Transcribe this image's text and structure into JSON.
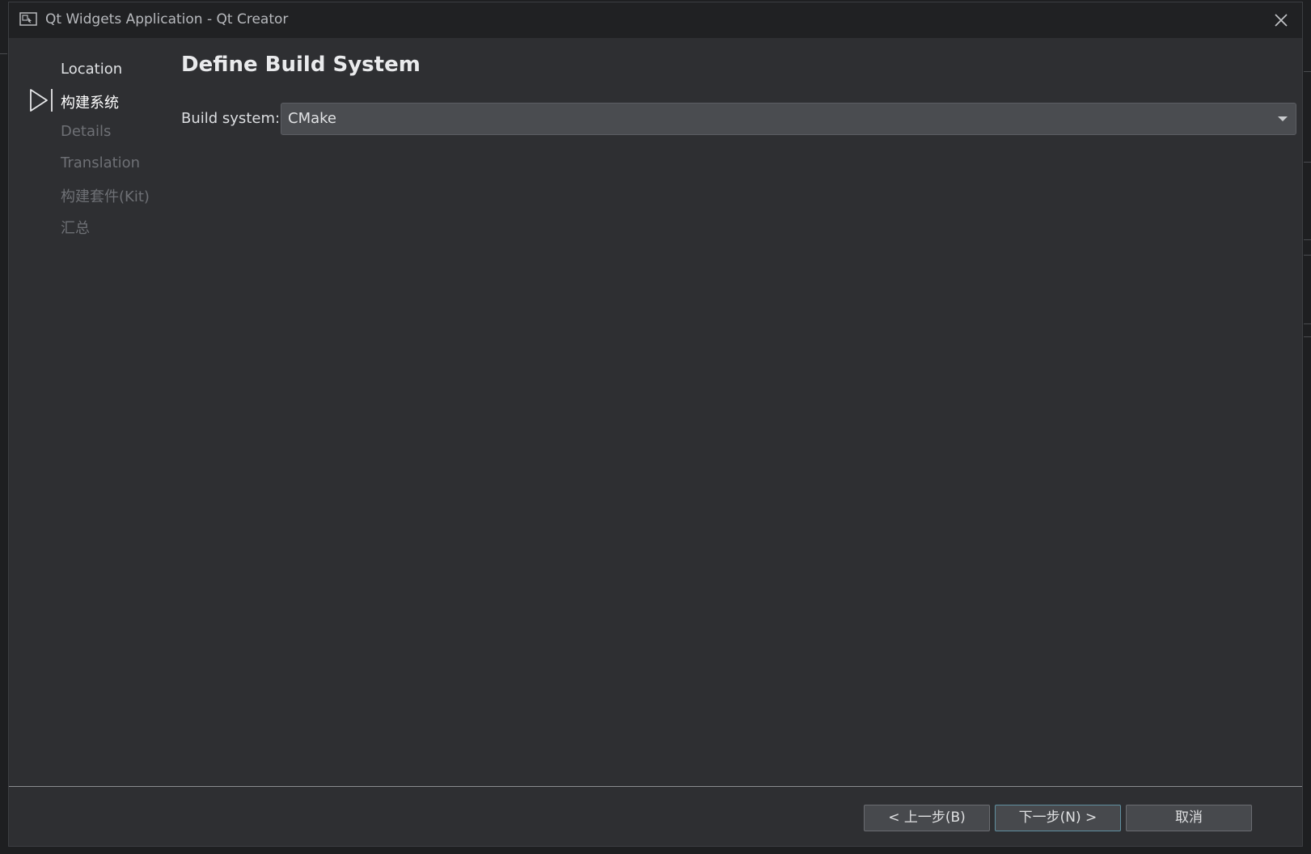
{
  "window": {
    "title": "Qt Widgets Application - Qt Creator",
    "icon": "qt-creator-app-icon",
    "close_icon": "close-icon"
  },
  "steps": [
    {
      "label": "Location",
      "state": "done"
    },
    {
      "label": "构建系统",
      "state": "current"
    },
    {
      "label": "Details",
      "state": "pending"
    },
    {
      "label": "Translation",
      "state": "pending"
    },
    {
      "label": "构建套件(Kit)",
      "state": "pending"
    },
    {
      "label": "汇总",
      "state": "pending"
    }
  ],
  "page": {
    "title": "Define Build System",
    "build_system_label": "Build system:",
    "build_system_value": "CMake"
  },
  "buttons": {
    "back": "< 上一步(B)",
    "next": "下一步(N) >",
    "cancel": "取消"
  },
  "colors": {
    "dialog_bg": "#2e2f32",
    "titlebar_bg": "#202123",
    "accent_border": "#5f8fa0"
  }
}
